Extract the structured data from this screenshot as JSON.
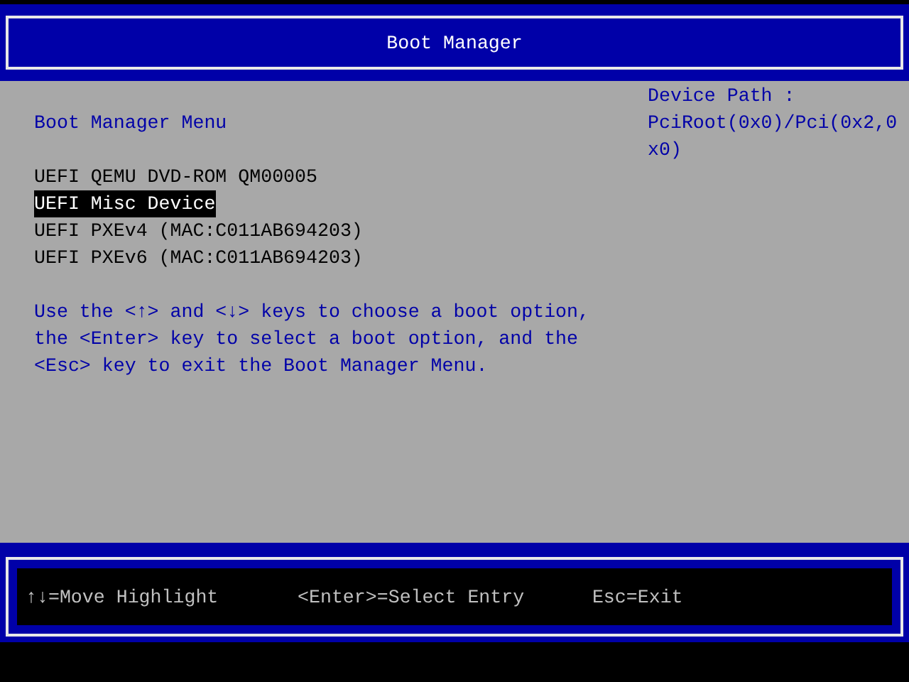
{
  "header": {
    "title": "Boot Manager"
  },
  "menu": {
    "title": "Boot Manager Menu",
    "items": [
      {
        "label": "UEFI QEMU DVD-ROM QM00005",
        "selected": false
      },
      {
        "label": "UEFI Misc Device",
        "selected": true
      },
      {
        "label": "UEFI PXEv4 (MAC:C011AB694203)",
        "selected": false
      },
      {
        "label": "UEFI PXEv6 (MAC:C011AB694203)",
        "selected": false
      }
    ],
    "help": "Use the <↑> and <↓> keys to choose a boot option, the <Enter> key to select a boot option, and the <Esc> key to exit the Boot Manager Menu."
  },
  "device_path": {
    "label": "Device Path :",
    "value": "PciRoot(0x0)/Pci(0x2,0x0)"
  },
  "footer": {
    "hints": [
      "↑↓=Move Highlight",
      "<Enter>=Select Entry",
      "Esc=Exit"
    ]
  }
}
